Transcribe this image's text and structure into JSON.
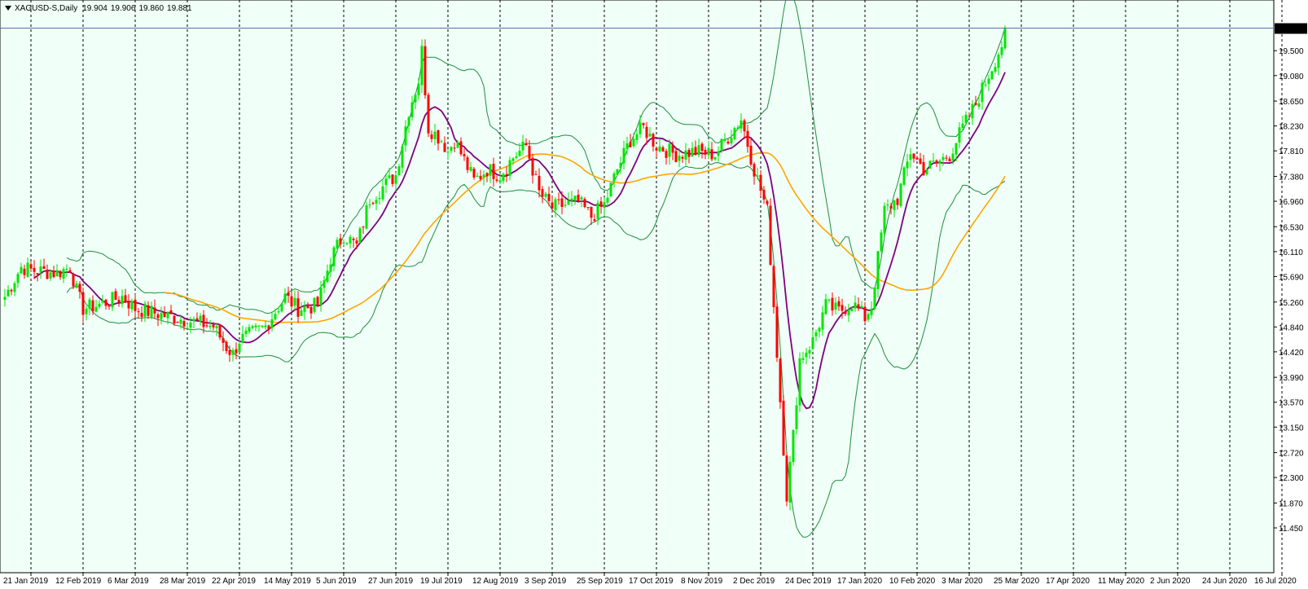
{
  "header": {
    "symbol": "XAGUSD-S,Daily",
    "open": "19.904",
    "high": "19.906",
    "low": "19.860",
    "close": "19.881"
  },
  "colors": {
    "background": "#F0FFF7",
    "bull": "#00E600",
    "bear": "#FF0000",
    "ma_fast": "#800080",
    "ma_slow": "#FFA500",
    "bands": "#1E8E3E",
    "current_line": "#5A6FB0",
    "grid": "#000000"
  },
  "chart_data": {
    "type": "candlestick",
    "title": "",
    "ylim": [
      11.45,
      20.3
    ],
    "y_ticks": [
      "11.450",
      "11.870",
      "12.300",
      "12.720",
      "13.150",
      "13.570",
      "13.990",
      "14.420",
      "14.840",
      "15.260",
      "15.690",
      "16.110",
      "16.530",
      "16.960",
      "17.380",
      "17.810",
      "18.230",
      "18.650",
      "19.080",
      "19.500"
    ],
    "current_price": "19.881",
    "x_labels": [
      "21 Jan 2019",
      "12 Feb 2019",
      "6 Mar 2019",
      "28 Mar 2019",
      "22 Apr 2019",
      "14 May 2019",
      "5 Jun 2019",
      "27 Jun 2019",
      "19 Jul 2019",
      "12 Aug 2019",
      "3 Sep 2019",
      "25 Sep 2019",
      "17 Oct 2019",
      "8 Nov 2019",
      "2 Dec 2019",
      "24 Dec 2019",
      "17 Jan 2020",
      "10 Feb 2020",
      "3 Mar 2020",
      "25 Mar 2020",
      "17 Apr 2020",
      "11 May 2020",
      "2 Jun 2020",
      "24 Jun 2020",
      "16 Jul 2020"
    ],
    "grid_bars": [
      8,
      24,
      40,
      56,
      72,
      88,
      104,
      120,
      136,
      152,
      168,
      184,
      200,
      216,
      232,
      248,
      264,
      280,
      296,
      312,
      328,
      344,
      360,
      376,
      392
    ],
    "bar_count": 394,
    "anchors": [
      [
        0,
        15.35
      ],
      [
        5,
        15.85
      ],
      [
        8,
        15.8
      ],
      [
        16,
        15.75
      ],
      [
        20,
        15.85
      ],
      [
        22,
        15.45
      ],
      [
        24,
        15.15
      ],
      [
        28,
        15.2
      ],
      [
        36,
        15.35
      ],
      [
        40,
        15.15
      ],
      [
        48,
        15.05
      ],
      [
        56,
        14.95
      ],
      [
        64,
        14.85
      ],
      [
        68,
        14.5
      ],
      [
        70,
        14.38
      ],
      [
        72,
        14.62
      ],
      [
        80,
        14.85
      ],
      [
        86,
        15.35
      ],
      [
        90,
        15.15
      ],
      [
        96,
        15.2
      ],
      [
        100,
        16.0
      ],
      [
        104,
        16.4
      ],
      [
        108,
        16.2
      ],
      [
        112,
        17.0
      ],
      [
        116,
        17.2
      ],
      [
        120,
        17.4
      ],
      [
        124,
        18.5
      ],
      [
        127,
        19.0
      ],
      [
        128,
        19.5
      ],
      [
        130,
        18.2
      ],
      [
        134,
        18.0
      ],
      [
        136,
        17.8
      ],
      [
        138,
        18.0
      ],
      [
        144,
        17.3
      ],
      [
        148,
        17.5
      ],
      [
        152,
        17.4
      ],
      [
        156,
        17.7
      ],
      [
        160,
        17.9
      ],
      [
        164,
        17.1
      ],
      [
        168,
        16.85
      ],
      [
        176,
        16.95
      ],
      [
        180,
        16.7
      ],
      [
        184,
        16.9
      ],
      [
        188,
        17.5
      ],
      [
        192,
        18.0
      ],
      [
        196,
        18.2
      ],
      [
        200,
        17.9
      ],
      [
        206,
        17.75
      ],
      [
        212,
        17.8
      ],
      [
        218,
        17.75
      ],
      [
        226,
        18.35
      ],
      [
        230,
        17.5
      ],
      [
        234,
        16.8
      ],
      [
        236,
        15.2
      ],
      [
        240,
        12.0
      ],
      [
        242,
        13.0
      ],
      [
        244,
        14.3
      ],
      [
        248,
        14.6
      ],
      [
        252,
        15.2
      ],
      [
        256,
        15.1
      ],
      [
        260,
        15.25
      ],
      [
        264,
        15.0
      ],
      [
        266,
        15.2
      ],
      [
        270,
        16.8
      ],
      [
        274,
        17.0
      ],
      [
        278,
        17.8
      ],
      [
        282,
        17.5
      ],
      [
        286,
        17.6
      ],
      [
        290,
        17.75
      ],
      [
        294,
        18.2
      ],
      [
        298,
        18.6
      ],
      [
        302,
        19.1
      ],
      [
        306,
        19.6
      ],
      [
        307,
        19.88
      ]
    ],
    "series": [
      {
        "name": "",
        "kind": "ma_fast",
        "period": 10
      },
      {
        "name": "",
        "kind": "ma_slow",
        "period": 50
      },
      {
        "name": "",
        "kind": "bands",
        "period": 20,
        "deviation": 2
      }
    ]
  }
}
